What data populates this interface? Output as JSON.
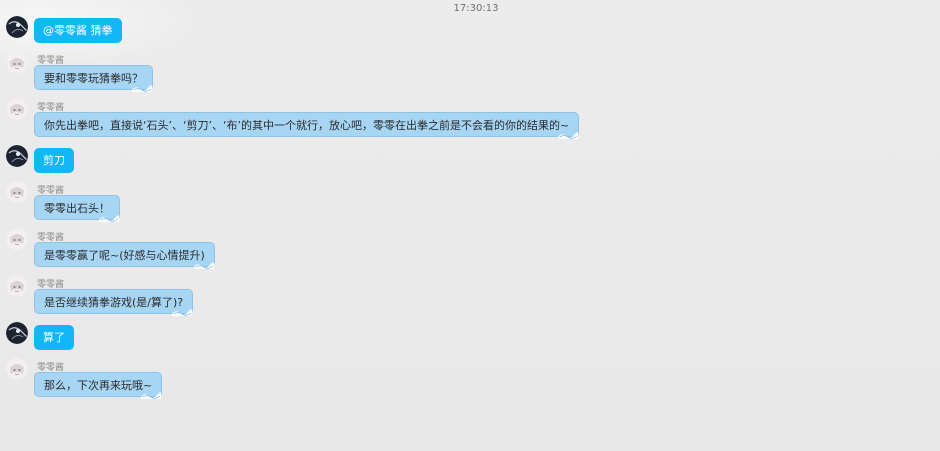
{
  "timestamp": "17:30:13",
  "messages": [
    {
      "from": "self",
      "sender": "",
      "text": "@零零酱 猜拳"
    },
    {
      "from": "other",
      "sender": "零零酱",
      "text": "要和零零玩猜拳吗？"
    },
    {
      "from": "other",
      "sender": "零零酱",
      "text": "你先出拳吧，直接说‘石头’、‘剪刀’、‘布’的其中一个就行，放心吧，零零在出拳之前是不会看的你的结果的~"
    },
    {
      "from": "self",
      "sender": "",
      "text": "剪刀"
    },
    {
      "from": "other",
      "sender": "零零酱",
      "text": "零零出石头！"
    },
    {
      "from": "other",
      "sender": "零零酱",
      "text": "是零零赢了呢~(好感与心情提升)"
    },
    {
      "from": "other",
      "sender": "零零酱",
      "text": "是否继续猜拳游戏(是/算了)?"
    },
    {
      "from": "self",
      "sender": "",
      "text": "算了"
    },
    {
      "from": "other",
      "sender": "零零酱",
      "text": "那么，下次再来玩哦~"
    }
  ],
  "colors": {
    "background": "#e9e9e9",
    "self_bubble": "#12b7f5",
    "other_bubble": "#a7d6f5"
  },
  "icons": {
    "self_avatar": "dark-avatar-icon",
    "other_avatar": "anime-girl-avatar-icon"
  }
}
